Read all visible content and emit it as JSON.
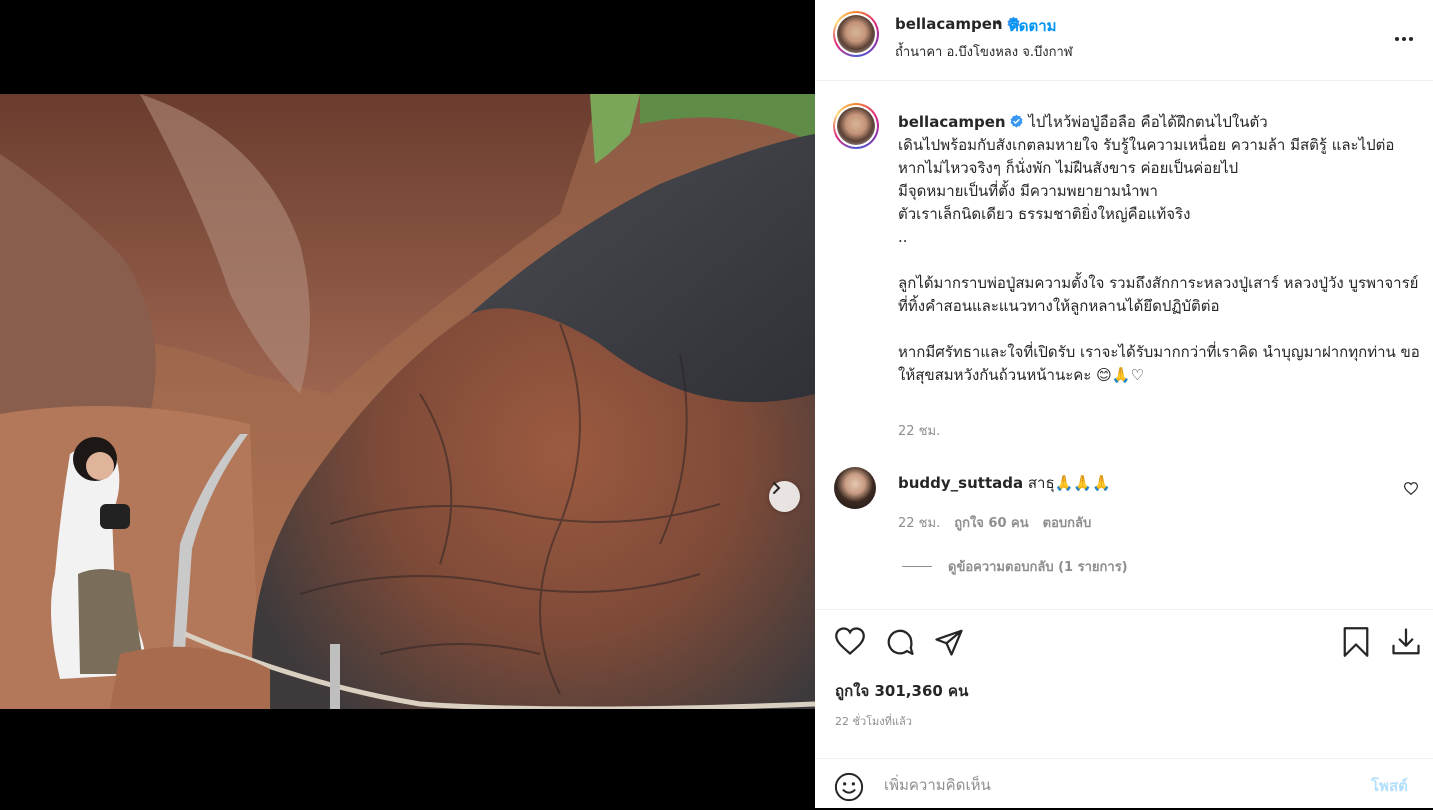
{
  "post": {
    "username": "bellacampen",
    "follow_label": "ติดตาม",
    "separator": "•",
    "location": "ถ้ำนาคา อ.บึงโขงหลง จ.บึงกาฬ",
    "more_label": "•••",
    "carousel": {
      "slide_count": 9,
      "active_index": 0
    }
  },
  "caption": {
    "username": "bellacampen",
    "text": "ไปไหว้พ่อปู่อือลือ คือได้ฝึกตนไปในตัว\nเดินไปพร้อมกับสังเกตลมหายใจ รับรู้ในความเหนื่อย ความล้า มีสติรู้ และไปต่อ\nหากไม่ไหวจริงๆ ก็นั่งพัก ไม่ฝืนสังขาร ค่อยเป็นค่อยไป\nมีจุดหมายเป็นที่ตั้ง มีความพยายามนำพา\nตัวเราเล็กนิดเดียว ธรรมชาติยิ่งใหญ่คือแท้จริง\n..\n\nลูกได้มากราบพ่อปู่สมความตั้งใจ รวมถึงสักการะหลวงปู่เสาร์ หลวงปู่วัง บูรพาจารย์ที่ทิ้งคำสอนและแนวทางให้ลูกหลานได้ยึดปฏิบัติต่อ\n\nหากมีศรัทธาและใจที่เปิดรับ เราจะได้รับมากกว่าที่เราคิด นำบุญมาฝากทุกท่าน ขอให้สุขสมหวังกันถ้วนหน้านะคะ 😊🙏♡",
    "time": "22 ชม."
  },
  "comment": {
    "username": "buddy_suttada",
    "text": "สาธุ🙏🙏🙏",
    "time": "22 ชม.",
    "likes": "ถูกใจ 60 คน",
    "reply_label": "ตอบกลับ",
    "view_replies": "ดูข้อความตอบกลับ (1 รายการ)"
  },
  "footer": {
    "likes": "ถูกใจ 301,360 คน",
    "time_ago": "22 ชั่วโมงที่แล้ว",
    "comment_placeholder": "เพิ่มความคิดเห็น",
    "post_label": "โพสต์"
  },
  "icons": {
    "like": "heart-icon",
    "comment": "comment-bubble-icon",
    "share": "paper-plane-icon",
    "save": "bookmark-icon",
    "download": "download-icon",
    "emoji": "smiley-icon",
    "verified": "verified-badge-icon",
    "next": "chevron-right-icon"
  },
  "colors": {
    "accent": "#0095f6",
    "post_disabled": "#b2dffc",
    "muted": "#8e8e8e",
    "text": "#262626"
  }
}
